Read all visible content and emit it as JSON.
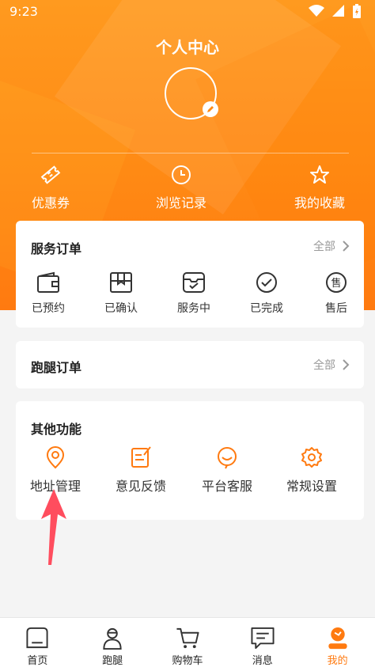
{
  "status_bar": {
    "time": "9:23"
  },
  "header": {
    "title": "个人中心"
  },
  "quick_links": [
    {
      "label": "优惠券",
      "icon": "ticket-icon"
    },
    {
      "label": "浏览记录",
      "icon": "clock-icon"
    },
    {
      "label": "我的收藏",
      "icon": "star-icon"
    }
  ],
  "service_orders": {
    "title": "服务订单",
    "more": "全部",
    "items": [
      {
        "label": "已预约",
        "icon": "wallet-icon"
      },
      {
        "label": "已确认",
        "icon": "box-icon"
      },
      {
        "label": "服务中",
        "icon": "inbox-icon"
      },
      {
        "label": "已完成",
        "icon": "check-circle-icon"
      },
      {
        "label": "售后",
        "icon": "after-sale-icon",
        "glyph": "售"
      }
    ]
  },
  "errand_orders": {
    "title": "跑腿订单",
    "more": "全部"
  },
  "other_functions": {
    "title": "其他功能",
    "items": [
      {
        "label": "地址管理",
        "icon": "location-pin-icon"
      },
      {
        "label": "意见反馈",
        "icon": "feedback-edit-icon"
      },
      {
        "label": "平台客服",
        "icon": "customer-service-icon"
      },
      {
        "label": "常规设置",
        "icon": "gear-icon"
      }
    ]
  },
  "tab_bar": {
    "tabs": [
      {
        "label": "首页",
        "icon": "home-icon"
      },
      {
        "label": "跑腿",
        "icon": "courier-icon"
      },
      {
        "label": "购物车",
        "icon": "cart-icon"
      },
      {
        "label": "消息",
        "icon": "message-icon"
      },
      {
        "label": "我的",
        "icon": "profile-icon",
        "active": true
      }
    ]
  },
  "colors": {
    "accent": "#ff7a10",
    "header_top": "#ff9a1f",
    "annotation": "#ff4d5e"
  }
}
